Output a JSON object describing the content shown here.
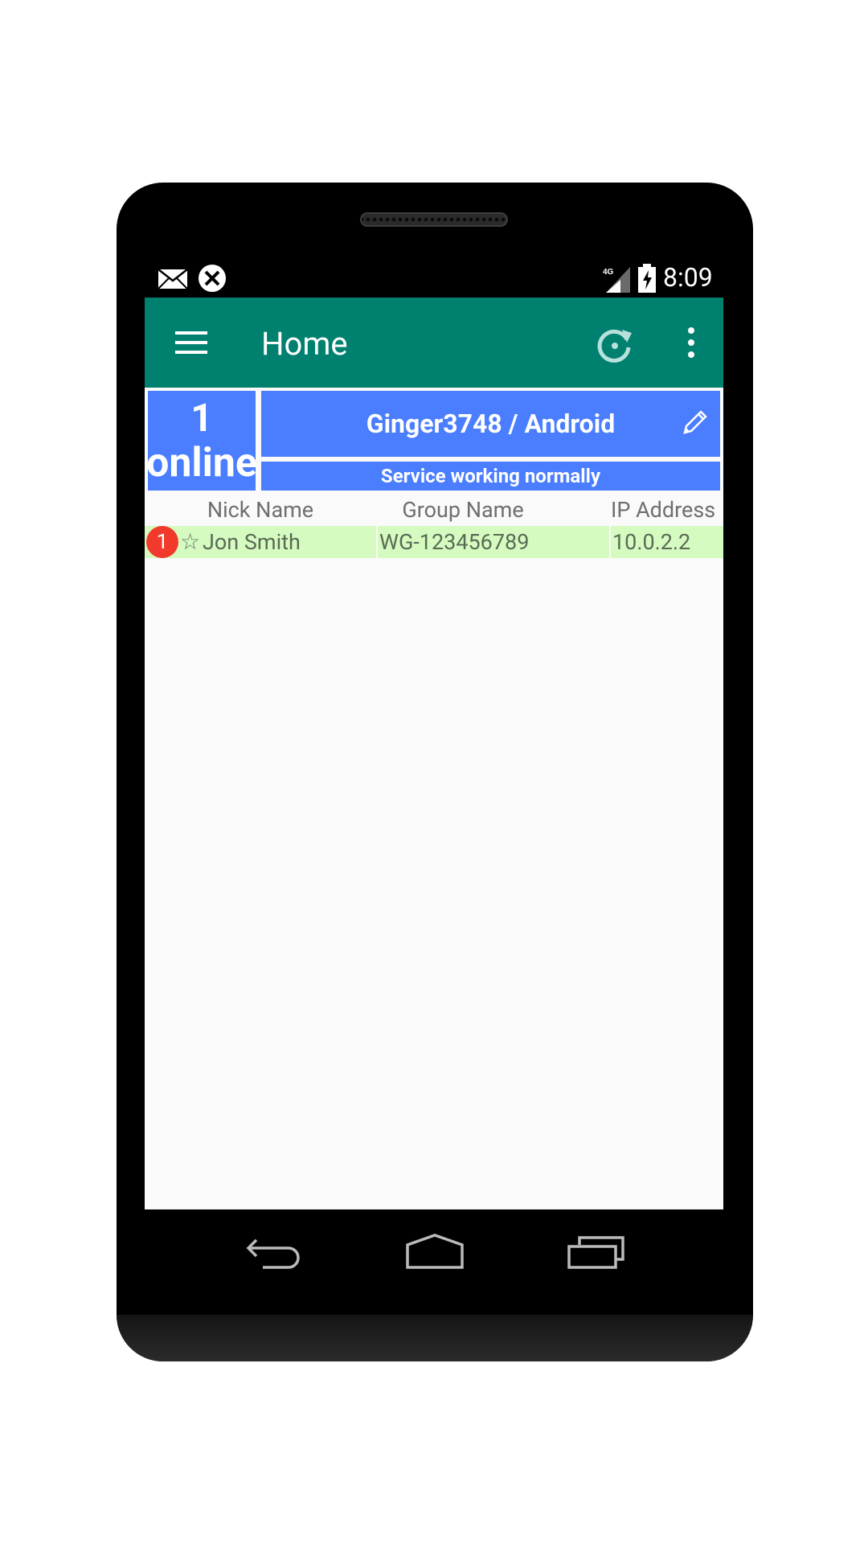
{
  "status_bar": {
    "time": "8:09",
    "network": "4G"
  },
  "appbar": {
    "title": "Home"
  },
  "summary": {
    "online_count": "1",
    "online_label": "online",
    "device_name": "Ginger3748 / Android",
    "service_status": "Service working normally"
  },
  "table": {
    "headers": {
      "nick": "Nick Name",
      "group": "Group Name",
      "ip": "IP Address"
    },
    "rows": [
      {
        "badge": "1",
        "star": "☆",
        "nick": "Jon Smith",
        "group": "WG-123456789",
        "ip": "10.0.2.2"
      }
    ]
  },
  "colors": {
    "appbar": "#008170",
    "summary_blue": "#4a7eff",
    "row_green": "#d6fbc1",
    "badge_red": "#f23a2c"
  },
  "icons": {
    "status_left": [
      "mail-icon",
      "x-circle-icon"
    ],
    "status_right": [
      "signal-icon",
      "battery-charging-icon"
    ],
    "appbar": [
      "menu-icon",
      "refresh-icon",
      "overflow-menu-icon"
    ],
    "summary": [
      "edit-icon"
    ],
    "navbar": [
      "back-icon",
      "home-icon",
      "recents-icon"
    ]
  }
}
